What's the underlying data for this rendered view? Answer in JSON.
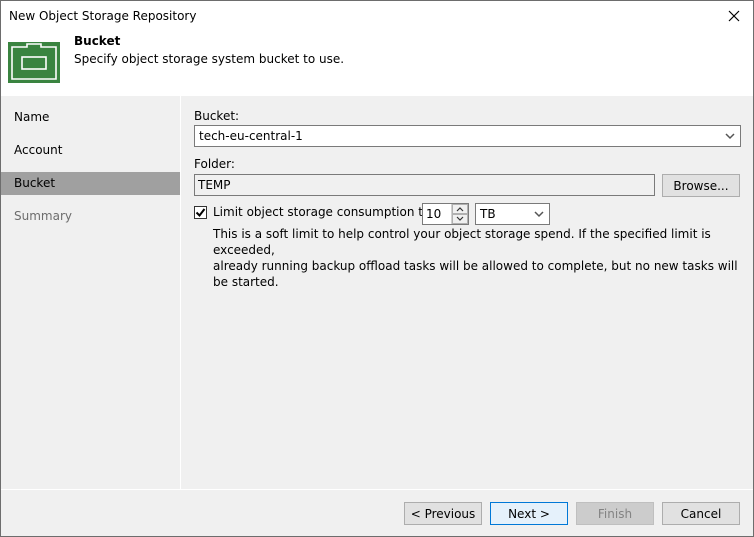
{
  "window": {
    "title": "New Object Storage Repository",
    "close_icon": "close-icon"
  },
  "header": {
    "icon": "bucket-icon",
    "title": "Bucket",
    "description": "Specify object storage system bucket to use.",
    "icon_color": "#3a8440"
  },
  "sidebar": {
    "items": [
      {
        "label": "Name",
        "state": "normal"
      },
      {
        "label": "Account",
        "state": "normal"
      },
      {
        "label": "Bucket",
        "state": "active"
      },
      {
        "label": "Summary",
        "state": "disabled"
      }
    ]
  },
  "form": {
    "bucket_label": "Bucket:",
    "bucket_value": "tech-eu-central-1",
    "folder_label": "Folder:",
    "folder_value": "TEMP",
    "browse_label": "Browse...",
    "limit_checkbox_label": "Limit object storage consumption to:",
    "limit_checked": true,
    "limit_value": "10",
    "limit_unit": "TB",
    "note_line1": "This is a soft limit to help control your object storage spend. If the specified limit is exceeded,",
    "note_line2": "already running backup offload tasks will be allowed to complete, but no new tasks will be started."
  },
  "footer": {
    "previous_label": "< Previous",
    "next_label": "Next >",
    "finish_label": "Finish",
    "cancel_label": "Cancel"
  }
}
